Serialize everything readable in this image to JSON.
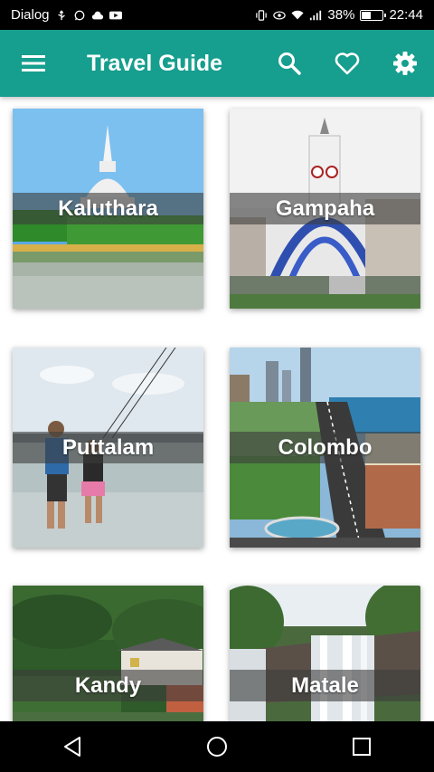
{
  "status_bar": {
    "carrier": "Dialog",
    "battery": "38%",
    "battery_level": 0.38,
    "time": "22:44"
  },
  "app_bar": {
    "title": "Travel Guide",
    "color": "#169e8e",
    "icons": [
      "menu-icon",
      "search-icon",
      "heart-icon",
      "settings-icon"
    ]
  },
  "destinations": [
    {
      "name": "Kaluthara"
    },
    {
      "name": "Gampaha"
    },
    {
      "name": "Puttalam"
    },
    {
      "name": "Colombo"
    },
    {
      "name": "Kandy"
    },
    {
      "name": "Matale"
    }
  ],
  "nav_bar": {
    "icons": [
      "back-icon",
      "home-icon",
      "recents-icon"
    ]
  }
}
